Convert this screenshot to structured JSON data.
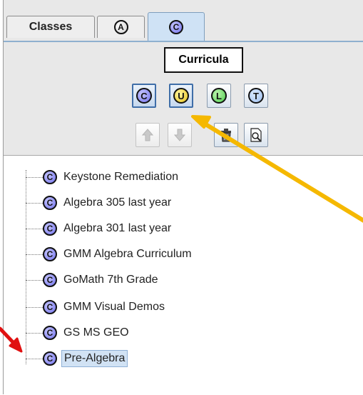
{
  "tabs": [
    {
      "label": "Classes",
      "active": false
    },
    {
      "icon": "a-circle-icon",
      "glyph": "A",
      "active": false
    },
    {
      "icon": "c-circle-icon",
      "glyph": "C",
      "active": true
    }
  ],
  "tooltip": "Curricula",
  "toolbar": {
    "filter_buttons": [
      {
        "glyph": "C",
        "name": "curricula-filter",
        "active": true
      },
      {
        "glyph": "U",
        "name": "units-filter",
        "active": true
      },
      {
        "glyph": "L",
        "name": "lessons-filter",
        "active": false
      },
      {
        "glyph": "T",
        "name": "topics-filter",
        "active": false
      }
    ],
    "action_buttons": [
      {
        "icon": "arrow-up-icon",
        "enabled": false
      },
      {
        "icon": "arrow-down-icon",
        "enabled": false
      },
      {
        "icon": "trash-icon",
        "enabled": true
      },
      {
        "icon": "preview-icon",
        "enabled": true
      }
    ]
  },
  "tree": {
    "items": [
      {
        "glyph": "C",
        "label": "Keystone Remediation"
      },
      {
        "glyph": "C",
        "label": "Algebra 305 last year"
      },
      {
        "glyph": "C",
        "label": "Algebra 301 last year"
      },
      {
        "glyph": "C",
        "label": "GMM Algebra Curriculum"
      },
      {
        "glyph": "C",
        "label": "GoMath 7th Grade"
      },
      {
        "glyph": "C",
        "label": "GMM Visual Demos"
      },
      {
        "glyph": "C",
        "label": "GS MS GEO"
      },
      {
        "glyph": "C",
        "label": "Pre-Algebra",
        "selected": true
      }
    ]
  },
  "annotations": {
    "arrow_orange_color": "#f5b800",
    "arrow_red_color": "#e01010"
  }
}
